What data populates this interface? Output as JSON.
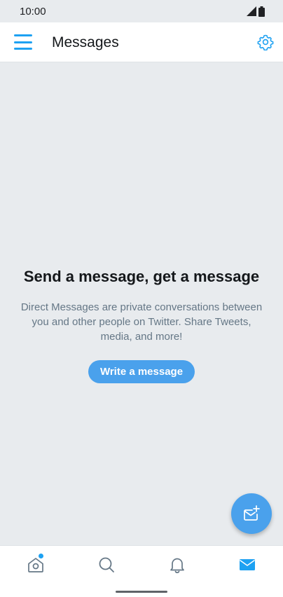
{
  "status_bar": {
    "time": "10:00",
    "icons": [
      "signal-icon",
      "battery-icon"
    ]
  },
  "header": {
    "title": "Messages",
    "left_icon": "menu-icon",
    "right_icon": "gear-icon"
  },
  "empty_state": {
    "title": "Send a message, get a message",
    "description": "Direct Messages are private conversations between you and other people on Twitter. Share Tweets, media, and more!",
    "button_label": "Write a message"
  },
  "fab": {
    "icon": "new-message-icon"
  },
  "bottom_nav": {
    "items": [
      {
        "icon": "home-icon",
        "active": false,
        "has_badge": true
      },
      {
        "icon": "search-icon",
        "active": false
      },
      {
        "icon": "bell-icon",
        "active": false
      },
      {
        "icon": "mail-icon",
        "active": true
      }
    ]
  },
  "colors": {
    "accent": "#1da1f2",
    "button": "#4aa1ec",
    "background": "#e8ebee",
    "text_primary": "#14171a",
    "text_secondary": "#657786"
  }
}
